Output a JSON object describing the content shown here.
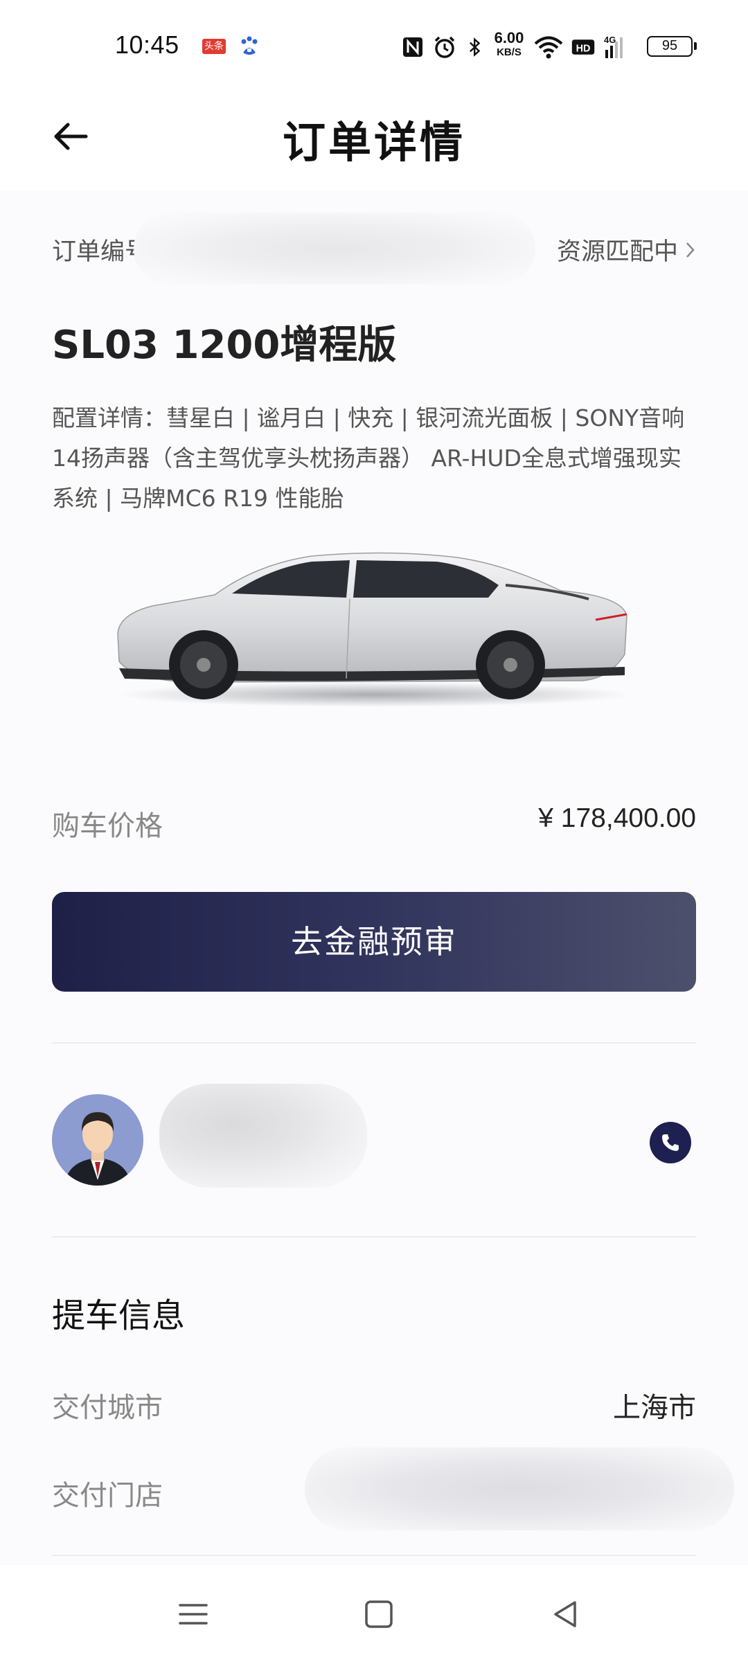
{
  "status_bar": {
    "time": "10:45",
    "app_badge": "头条",
    "net_speed_value": "6.00",
    "net_speed_unit": "KB/S",
    "hd_label": "HD",
    "network_label": "4G",
    "battery": "95"
  },
  "header": {
    "title": "订单详情"
  },
  "order": {
    "number_label": "订单编号",
    "status": "资源匹配中",
    "model_name": "SL03 1200增程版",
    "config_details": "配置详情：彗星白 | 谧月白 | 快充 | 银河流光面板 | SONY音响14扬声器（含主驾优享头枕扬声器） AR-HUD全息式增强现实系统 | 马牌MC6 R19 性能胎",
    "price_label": "购车价格",
    "price_value": "¥ 178,400.00",
    "finance_button": "去金融预审"
  },
  "pickup": {
    "section_title": "提车信息",
    "city_label": "交付城市",
    "city_value": "上海市",
    "store_label": "交付门店"
  },
  "colors": {
    "button_start": "#1e2048",
    "button_end": "#4d506c",
    "phone_button": "#1d2050",
    "avatar_bg": "#8c9bd0"
  },
  "icons": {
    "back": "arrow-left-icon",
    "chevron": "chevron-right-icon",
    "phone": "phone-icon",
    "nav_menu": "menu-icon",
    "nav_home": "square-home-icon",
    "nav_back": "triangle-back-icon"
  }
}
